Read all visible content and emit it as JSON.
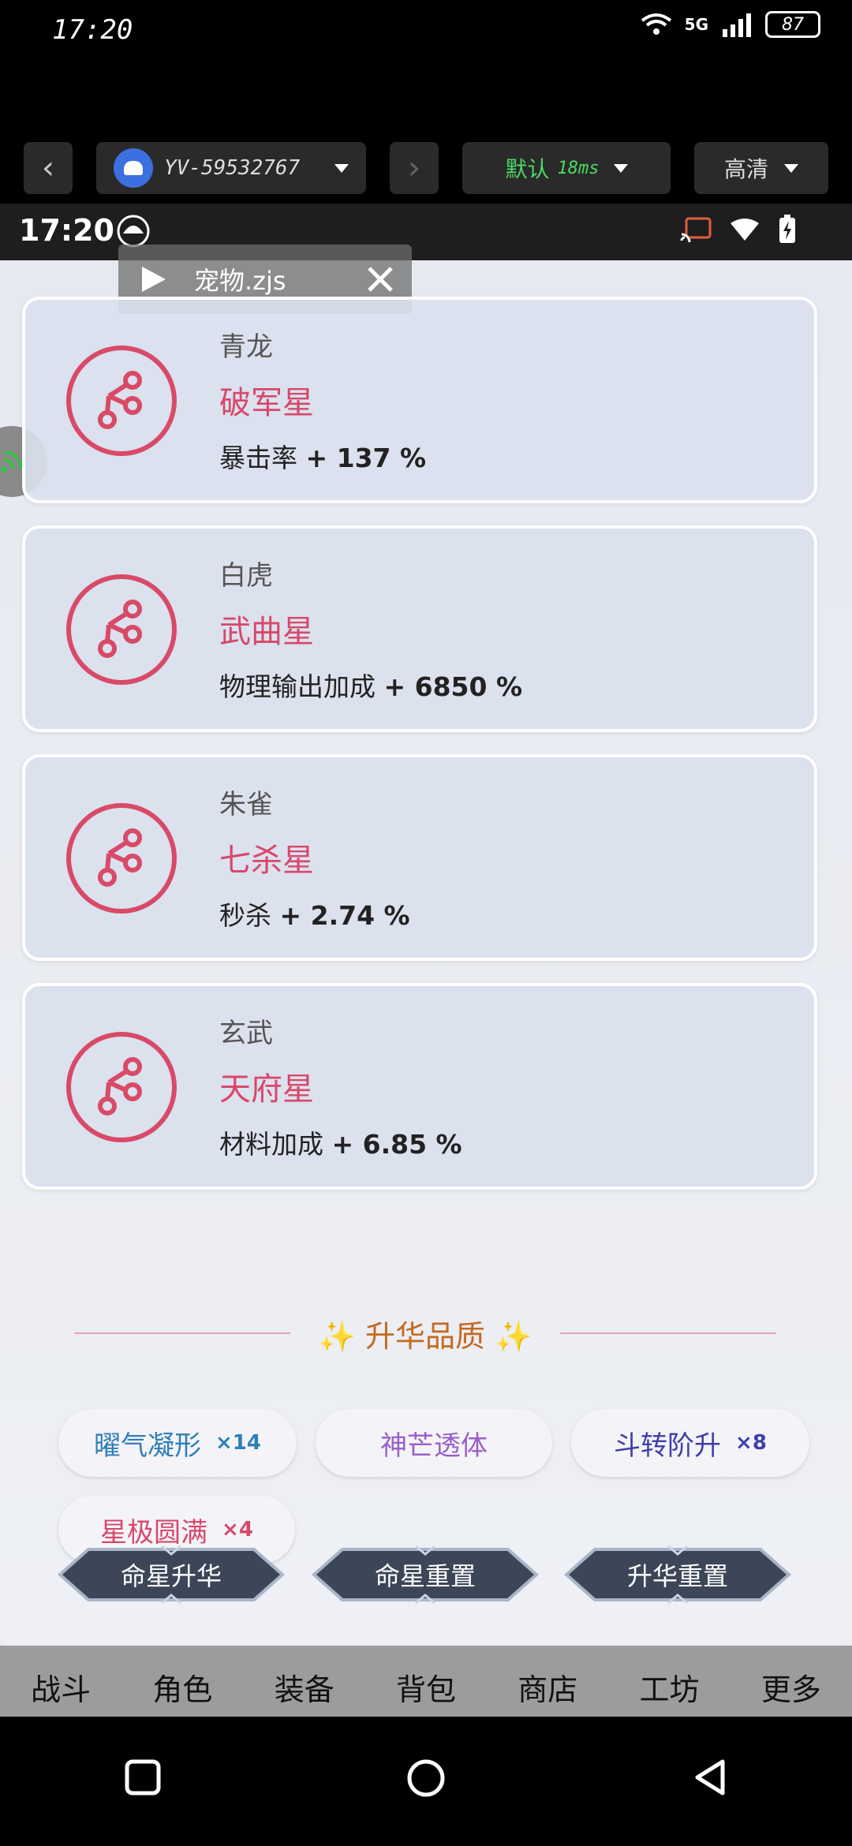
{
  "os_status": {
    "time": "17:20",
    "network": "5G",
    "battery": "87"
  },
  "toolbar": {
    "device_id": "YV-59532767",
    "line_label": "默认",
    "latency": "18ms",
    "quality": "高清"
  },
  "inner_status": {
    "time": "17:20"
  },
  "script_chip": {
    "name": "宠物.zjs"
  },
  "cards": [
    {
      "group": "青龙",
      "star": "破军星",
      "bonus_label": "暴击率",
      "bonus_value": "+ 137 %"
    },
    {
      "group": "白虎",
      "star": "武曲星",
      "bonus_label": "物理输出加成",
      "bonus_value": "+ 6850 %"
    },
    {
      "group": "朱雀",
      "star": "七杀星",
      "bonus_label": "秒杀",
      "bonus_value": "+ 2.74 %"
    },
    {
      "group": "玄武",
      "star": "天府星",
      "bonus_label": "材料加成",
      "bonus_value": "+ 6.85 %"
    }
  ],
  "quality_section": {
    "title": "✨ 升华品质 ✨"
  },
  "chips": [
    {
      "label": "曜气凝形",
      "count": "×14",
      "color": "#2f7fb8"
    },
    {
      "label": "神芒透体",
      "count": "",
      "color": "#9a5ec9"
    },
    {
      "label": "斗转阶升",
      "count": "×8",
      "color": "#3f3fa8"
    },
    {
      "label": "星极圆满",
      "count": "×4",
      "color": "#d8486a"
    }
  ],
  "actions": {
    "ascend": "命星升华",
    "reset_star": "命星重置",
    "reset_ascend": "升华重置"
  },
  "game_nav": [
    "战斗",
    "角色",
    "装备",
    "背包",
    "商店",
    "工坊",
    "更多"
  ],
  "colors": {
    "accent": "#d8486a",
    "title_gold": "#c46a1f",
    "latency_green": "#4cd964"
  }
}
